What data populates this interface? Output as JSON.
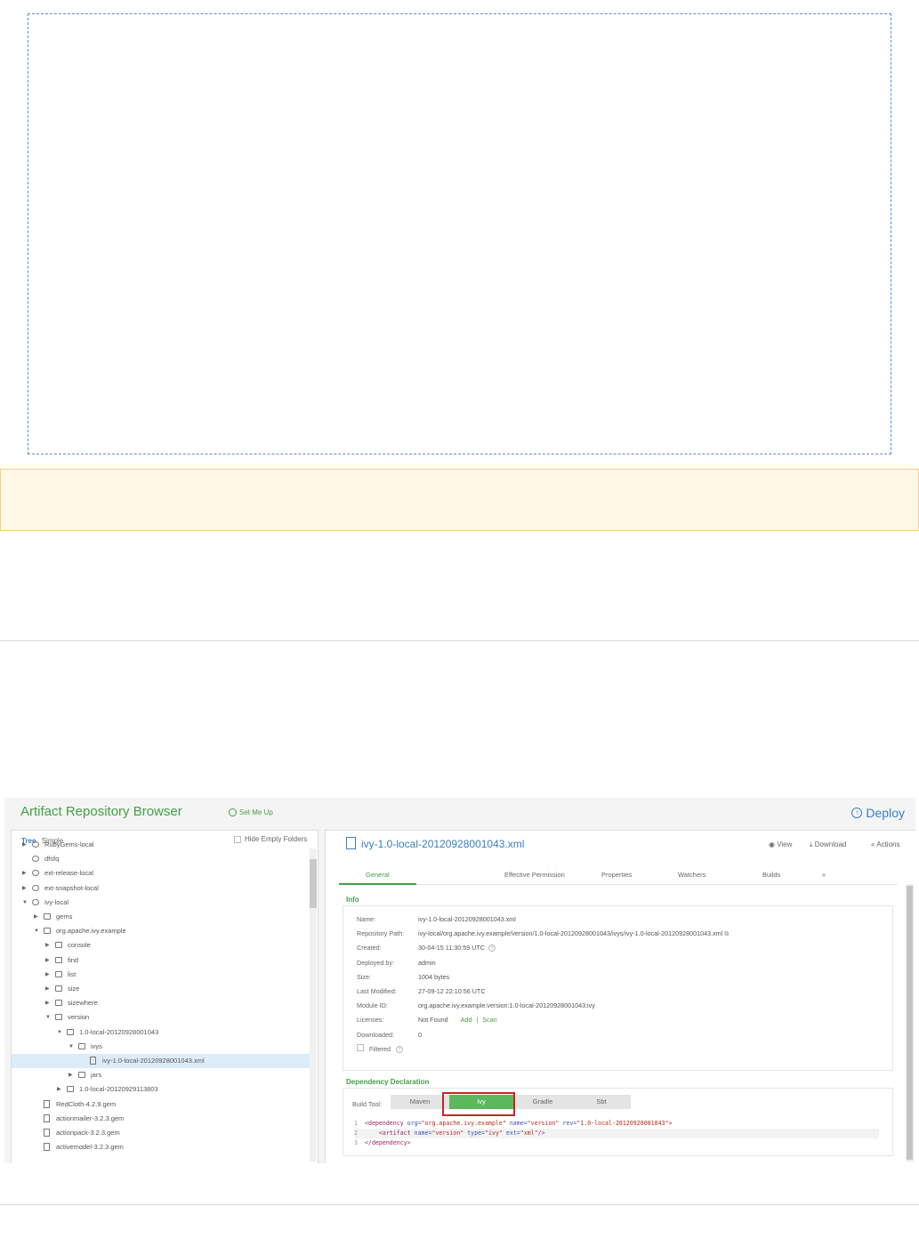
{
  "app": {
    "title": "Artifact Repository Browser",
    "set_me_up": "Set Me Up",
    "deploy": "Deploy"
  },
  "tree": {
    "tab_tree": "Tree",
    "tab_simple": "Simple",
    "hide_empty": "Hide Empty Folders",
    "items": [
      {
        "label": "RubyGems-local",
        "level": 1,
        "icon": "repo",
        "arrow": "right"
      },
      {
        "label": "dfsfq",
        "level": 1,
        "icon": "repo",
        "arrow": ""
      },
      {
        "label": "ext-release-local",
        "level": 1,
        "icon": "repo",
        "arrow": "right"
      },
      {
        "label": "ext-snapshot-local",
        "level": 1,
        "icon": "repo",
        "arrow": "right"
      },
      {
        "label": "ivy-local",
        "level": 1,
        "icon": "repo",
        "arrow": "down"
      },
      {
        "label": "gems",
        "level": 2,
        "icon": "folder",
        "arrow": "right"
      },
      {
        "label": "org.apache.ivy.example",
        "level": 2,
        "icon": "folder",
        "arrow": "down"
      },
      {
        "label": "console",
        "level": 3,
        "icon": "folder",
        "arrow": "right"
      },
      {
        "label": "find",
        "level": 3,
        "icon": "folder",
        "arrow": "right"
      },
      {
        "label": "list",
        "level": 3,
        "icon": "folder",
        "arrow": "right"
      },
      {
        "label": "size",
        "level": 3,
        "icon": "folder",
        "arrow": "right"
      },
      {
        "label": "sizewhere",
        "level": 3,
        "icon": "folder",
        "arrow": "right"
      },
      {
        "label": "version",
        "level": 3,
        "icon": "folder",
        "arrow": "down"
      },
      {
        "label": "1.0-local-20120928001043",
        "level": 4,
        "icon": "folder",
        "arrow": "down"
      },
      {
        "label": "ivys",
        "level": 5,
        "icon": "folder",
        "arrow": "down"
      },
      {
        "label": "ivy-1.0-local-20120928001043.xml",
        "level": 6,
        "icon": "file",
        "arrow": "",
        "selected": true
      },
      {
        "label": "jars",
        "level": 5,
        "icon": "folder",
        "arrow": "right"
      },
      {
        "label": "1.0-local-20120929113803",
        "level": 4,
        "icon": "folder",
        "arrow": "right"
      },
      {
        "label": "RedCloth-4.2.9.gem",
        "level": 2,
        "icon": "file",
        "arrow": ""
      },
      {
        "label": "actionmailer-3.2.3.gem",
        "level": 2,
        "icon": "file",
        "arrow": ""
      },
      {
        "label": "actionpack-3.2.3.gem",
        "level": 2,
        "icon": "file",
        "arrow": ""
      },
      {
        "label": "activemodel-3.2.3.gem",
        "level": 2,
        "icon": "file",
        "arrow": ""
      }
    ]
  },
  "detail": {
    "title": "ivy-1.0-local-20120928001043.xml",
    "actions": {
      "view": "View",
      "download": "Download",
      "actions": "Actions"
    },
    "tabs": [
      "General",
      "Effective Permission",
      "Properties",
      "Watchers",
      "Builds"
    ],
    "more_tabs": "»",
    "info_title": "Info",
    "info": [
      {
        "key": "Name:",
        "value": "ivy-1.0-local-20120928001043.xml"
      },
      {
        "key": "Repository Path:",
        "value": "ivy-local/org.apache.ivy.example/version/1.0-local-20120928001043/ivys/ivy-1.0-local-20120928001043.xml"
      },
      {
        "key": "Created:",
        "value": "30-04-15 11:30:59 UTC"
      },
      {
        "key": "Deployed by:",
        "value": "admin"
      },
      {
        "key": "Size:",
        "value": "1004 bytes"
      },
      {
        "key": "Last Modified:",
        "value": "27-09-12 22:10:56 UTC"
      },
      {
        "key": "Module ID:",
        "value": "org.apache.ivy.example:version:1.0-local-20120928001043:ivy"
      },
      {
        "key": "Licenses:",
        "value": "Not Found"
      },
      {
        "key": "Downloaded:",
        "value": "0"
      }
    ],
    "license_add": "Add",
    "license_sep": "|",
    "license_scan": "Scan",
    "filtered": "Filtered",
    "dep_title": "Dependency Declaration",
    "build_tool_label": "Build Tool:",
    "build_tools": [
      "Maven",
      "Ivy",
      "Gradle",
      "Sbt"
    ],
    "active_build_tool": "Ivy",
    "code": {
      "l1_tag": "<dependency",
      "l1_a1": "org=",
      "l1_v1": "\"org.apache.ivy.example\"",
      "l1_a2": "name=",
      "l1_v2": "\"version\"",
      "l1_a3": "rev=",
      "l1_v3": "\"1.0-local-20120928001043\"",
      "l1_end": ">",
      "l2_tag": "<artifact",
      "l2_a1": "name=",
      "l2_v1": "\"version\"",
      "l2_a2": "type=",
      "l2_v2": "\"ivy\"",
      "l2_a3": "ext=",
      "l2_v3": "\"xml\"",
      "l2_end": "/>",
      "l3_tag": "</dependency>"
    }
  },
  "colors": {
    "brand_green": "#43a047",
    "link_blue": "#3a7fc2",
    "highlight_red": "#cc2222"
  }
}
